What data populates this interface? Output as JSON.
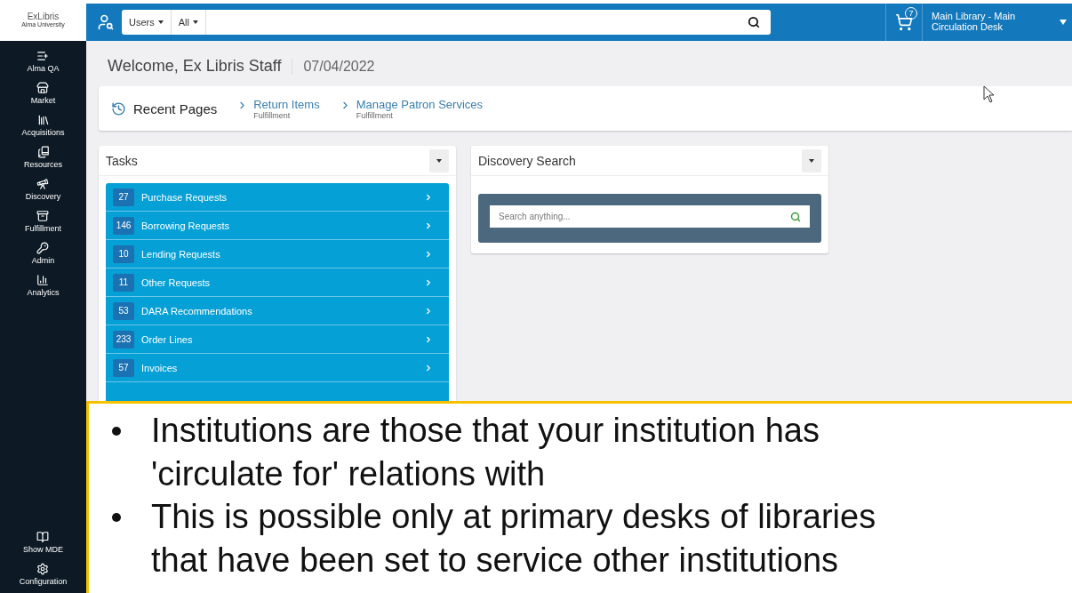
{
  "logo": {
    "brand": "ExLibris",
    "institution": "Alma University"
  },
  "sidebar": {
    "items": [
      {
        "label": "Alma QA"
      },
      {
        "label": "Market"
      },
      {
        "label": "Acquisitions"
      },
      {
        "label": "Resources"
      },
      {
        "label": "Discovery"
      },
      {
        "label": "Fulfillment"
      },
      {
        "label": "Admin"
      },
      {
        "label": "Analytics"
      }
    ],
    "bottom_items": [
      {
        "label": "Show MDE"
      },
      {
        "label": "Configuration"
      }
    ]
  },
  "header": {
    "search_type": "Users",
    "search_scope": "All",
    "cart_count": "7",
    "location": "Main Library - Main Circulation Desk"
  },
  "welcome": {
    "greeting": "Welcome, Ex Libris Staff",
    "date": "07/04/2022"
  },
  "recent_pages": {
    "title": "Recent Pages",
    "links": [
      {
        "label": "Return Items",
        "area": "Fulfillment"
      },
      {
        "label": "Manage Patron Services",
        "area": "Fulfillment"
      }
    ]
  },
  "tasks": {
    "title": "Tasks",
    "items": [
      {
        "count": "27",
        "label": "Purchase Requests"
      },
      {
        "count": "146",
        "label": "Borrowing Requests"
      },
      {
        "count": "10",
        "label": "Lending Requests"
      },
      {
        "count": "11",
        "label": "Other Requests"
      },
      {
        "count": "53",
        "label": "DARA Recommendations"
      },
      {
        "count": "233",
        "label": "Order Lines"
      },
      {
        "count": "57",
        "label": "Invoices"
      }
    ]
  },
  "discovery_search": {
    "title": "Discovery Search",
    "placeholder": "Search anything..."
  },
  "callout": {
    "bullets": [
      "Institutions are those that your institution has 'circulate for' relations with",
      "This is possible only at primary desks of libraries that have been set to service other institutions"
    ]
  }
}
